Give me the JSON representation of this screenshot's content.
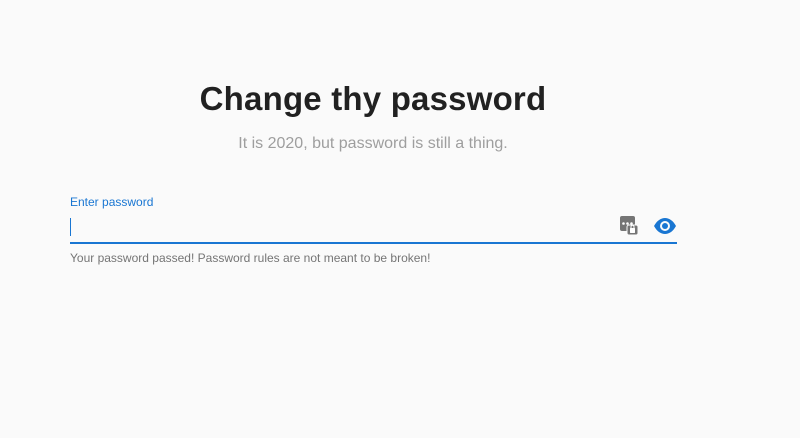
{
  "header": {
    "title": "Change thy password",
    "subtitle": "It is 2020, but password is still a thing."
  },
  "password_field": {
    "label": "Enter password",
    "value": "",
    "placeholder": "",
    "hint": "Your password passed! Password rules are not meant to be broken!",
    "keypad_icon": "password-keypad-icon",
    "visibility_icon": "eye-icon"
  },
  "colors": {
    "accent": "#1976d2",
    "title": "#212121",
    "subtitle": "#9e9e9e",
    "hint": "#757575",
    "background": "#fafafa"
  }
}
